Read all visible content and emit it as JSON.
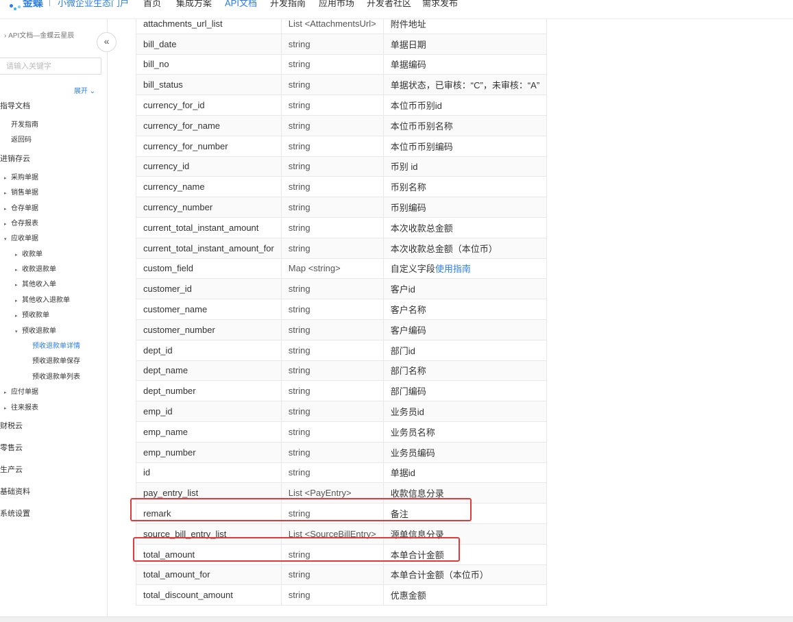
{
  "header": {
    "brand": "金蝶",
    "subtitle": "小微企业生态门户",
    "nav": [
      "首页",
      "集成方案",
      "API文档",
      "开发指南",
      "应用市场",
      "开发者社区",
      "需求发布"
    ],
    "active_nav": "API文档"
  },
  "sidebar": {
    "breadcrumb": "API文档—金蝶云星辰",
    "collapse_icon": "«",
    "search_placeholder": "请输入关键字",
    "expand_label": "展开",
    "tree": [
      {
        "label": "指导文档",
        "level": 0
      },
      {
        "label": "开发指南",
        "level": 1
      },
      {
        "label": "返回码",
        "level": 1
      },
      {
        "label": "进销存云",
        "level": 0
      },
      {
        "label": "采购单据",
        "level": 1,
        "caret": "▸"
      },
      {
        "label": "销售单据",
        "level": 1,
        "caret": "▸"
      },
      {
        "label": "仓存单据",
        "level": 1,
        "caret": "▸"
      },
      {
        "label": "仓存报表",
        "level": 1,
        "caret": "▸"
      },
      {
        "label": "应收单据",
        "level": 1,
        "caret": "▾"
      },
      {
        "label": "收款单",
        "level": 2,
        "caret": "▸"
      },
      {
        "label": "收款退款单",
        "level": 2,
        "caret": "▸"
      },
      {
        "label": "其他收入单",
        "level": 2,
        "caret": "▸"
      },
      {
        "label": "其他收入退款单",
        "level": 2,
        "caret": "▸"
      },
      {
        "label": "预收款单",
        "level": 2,
        "caret": "▸"
      },
      {
        "label": "预收退款单",
        "level": 2,
        "caret": "▾"
      },
      {
        "label": "预收退款单详情",
        "level": 3,
        "active": true
      },
      {
        "label": "预收退款单保存",
        "level": 3
      },
      {
        "label": "预收退款单列表",
        "level": 3
      },
      {
        "label": "应付单据",
        "level": 1,
        "caret": "▸"
      },
      {
        "label": "往来报表",
        "level": 1,
        "caret": "▸"
      },
      {
        "label": "财税云",
        "level": 0
      },
      {
        "label": "零售云",
        "level": 0
      },
      {
        "label": "生产云",
        "level": 0
      },
      {
        "label": "基础资料",
        "level": 0
      },
      {
        "label": "系统设置",
        "level": 0
      }
    ]
  },
  "table": {
    "rows": [
      [
        "attachments_url_list",
        "List <AttachmentsUrl>",
        "附件地址"
      ],
      [
        "bill_date",
        "string",
        "单据日期"
      ],
      [
        "bill_no",
        "string",
        "单据编码"
      ],
      [
        "bill_status",
        "string",
        "单据状态，已审核：“C”，未审核：“A”"
      ],
      [
        "currency_for_id",
        "string",
        "本位币币别id"
      ],
      [
        "currency_for_name",
        "string",
        "本位币币别名称"
      ],
      [
        "currency_for_number",
        "string",
        "本位币币别编码"
      ],
      [
        "currency_id",
        "string",
        "币别 id"
      ],
      [
        "currency_name",
        "string",
        "币别名称"
      ],
      [
        "currency_number",
        "string",
        "币别编码"
      ],
      [
        "current_total_instant_amount",
        "string",
        "本次收款总金额"
      ],
      [
        "current_total_instant_amount_for",
        "string",
        "本次收款总金额（本位币）"
      ],
      [
        "custom_field",
        "Map <string>",
        "自定义字段"
      ],
      [
        "customer_id",
        "string",
        "客户id"
      ],
      [
        "customer_name",
        "string",
        "客户名称"
      ],
      [
        "customer_number",
        "string",
        "客户编码"
      ],
      [
        "dept_id",
        "string",
        "部门id"
      ],
      [
        "dept_name",
        "string",
        "部门名称"
      ],
      [
        "dept_number",
        "string",
        "部门编码"
      ],
      [
        "emp_id",
        "string",
        "业务员id"
      ],
      [
        "emp_name",
        "string",
        "业务员名称"
      ],
      [
        "emp_number",
        "string",
        "业务员编码"
      ],
      [
        "id",
        "string",
        "单据id"
      ],
      [
        "pay_entry_list",
        "List <PayEntry>",
        "收款信息分录"
      ],
      [
        "remark",
        "string",
        "备注"
      ],
      [
        "source_bill_entry_list",
        "List <SourceBillEntry>",
        "源单信息分录"
      ],
      [
        "total_amount",
        "string",
        "本单合计金额"
      ],
      [
        "total_amount_for",
        "string",
        "本单合计金额（本位币）"
      ],
      [
        "total_discount_amount",
        "string",
        "优惠金额"
      ]
    ],
    "custom_field_link": "使用指南",
    "highlighted": [
      "pay_entry_list",
      "source_bill_entry_list"
    ]
  },
  "colors": {
    "accent": "#2b7de9",
    "highlight": "#e23a3a"
  }
}
